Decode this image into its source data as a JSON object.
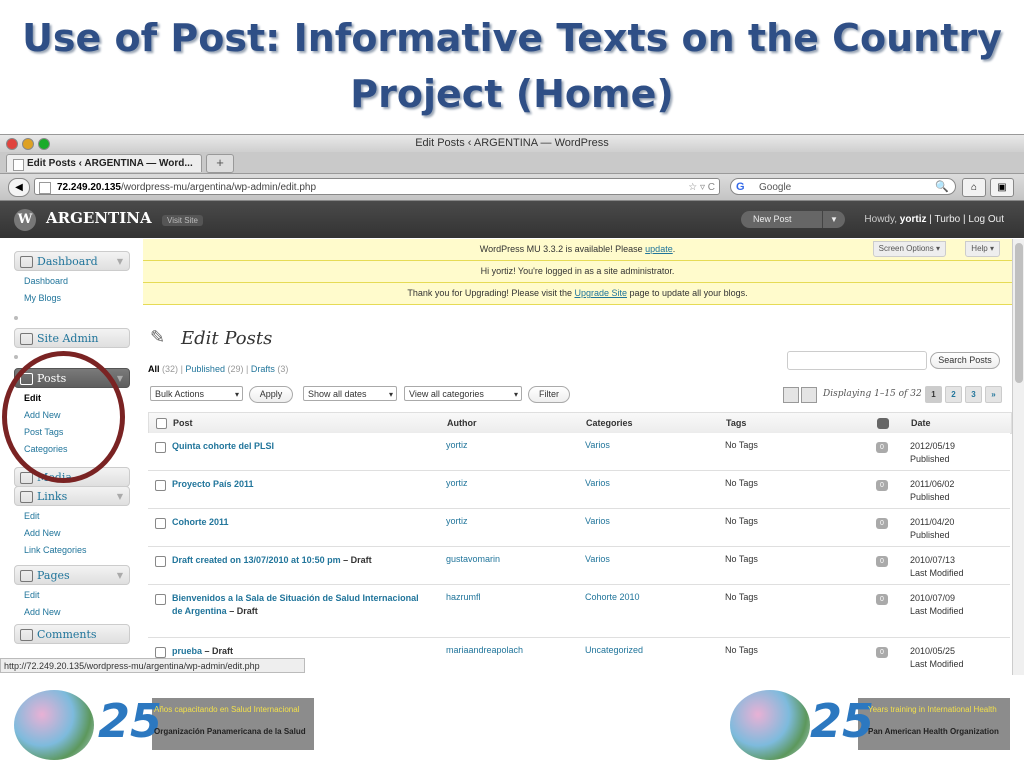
{
  "slide": {
    "title": "Use of Post: Informative Texts on the Country Project (Home)"
  },
  "browser": {
    "window_title": "Edit Posts ‹ ARGENTINA — WordPress",
    "tab_label": "Edit Posts ‹ ARGENTINA — Word...",
    "new_tab": "+",
    "back_icon": "◀",
    "url_host": "72.249.20.135",
    "url_path": "/wordpress-mu/argentina/wp-admin/edit.php",
    "url_right_controls": "☆ ▿ C",
    "search_engine_logo": "G",
    "search_placeholder": "Google",
    "search_icon": "🔍",
    "home_icon": "⌂",
    "menu_icon": "▣",
    "status_url": "http://72.249.20.135/wordpress-mu/argentina/wp-admin/edit.php"
  },
  "wp_header": {
    "logo": "W",
    "site_name": "ARGENTINA",
    "visit_site": "Visit Site",
    "new_post": "New Post",
    "dropdown_arrow": "▼",
    "howdy": "Howdy,",
    "user": "yortiz",
    "turbo": "Turbo",
    "logout": "Log Out",
    "separator": "|"
  },
  "notices": {
    "update_before": "WordPress MU 3.3.2 is available! Please ",
    "update_link": "update",
    "update_after": ".",
    "logged_in": "Hi yortiz! You're logged in as a site administrator.",
    "upgrade_before": "Thank you for Upgrading! Please visit the ",
    "upgrade_link": "Upgrade Site",
    "upgrade_after": " page to update all your blogs.",
    "screen_options": "Screen Options ▾",
    "help": "Help ▾"
  },
  "sidebar": {
    "dashboard": {
      "label": "Dashboard",
      "items": [
        "Dashboard",
        "My Blogs"
      ]
    },
    "site_admin": {
      "label": "Site Admin"
    },
    "posts": {
      "label": "Posts",
      "items": [
        "Edit",
        "Add New",
        "Post Tags",
        "Categories"
      ]
    },
    "media": {
      "label": "Media"
    },
    "links": {
      "label": "Links",
      "items": [
        "Edit",
        "Add New",
        "Link Categories"
      ]
    },
    "pages": {
      "label": "Pages",
      "items": [
        "Edit",
        "Add New"
      ]
    },
    "comments": {
      "label": "Comments"
    },
    "group_arrow": "▼"
  },
  "page": {
    "title": "Edit Posts",
    "pin_icon": "✎",
    "filter_all": "All",
    "filter_all_count": "(32)",
    "filter_published": "Published",
    "filter_published_count": "(29)",
    "filter_drafts": "Drafts",
    "filter_drafts_count": "(3)",
    "filter_separator": "|",
    "search_button": "Search Posts",
    "bulk_actions": "Bulk Actions",
    "apply": "Apply",
    "dates": "Show all dates",
    "categories": "View all categories",
    "filter": "Filter",
    "select_arrow": "▾",
    "displaying": "Displaying 1–15 of 32",
    "pages": [
      "1",
      "2",
      "3",
      "»"
    ]
  },
  "table": {
    "headers": {
      "post": "Post",
      "author": "Author",
      "categories": "Categories",
      "tags": "Tags",
      "date": "Date"
    },
    "rows": [
      {
        "title": "Quinta cohorte del PLSI",
        "status": "",
        "author": "yortiz",
        "category": "Varios",
        "tags": "No Tags",
        "comments": "0",
        "date": "2012/05/19",
        "state": "Published"
      },
      {
        "title": "Proyecto País 2011",
        "status": "",
        "author": "yortiz",
        "category": "Varios",
        "tags": "No Tags",
        "comments": "0",
        "date": "2011/06/02",
        "state": "Published"
      },
      {
        "title": "Cohorte 2011",
        "status": "",
        "author": "yortiz",
        "category": "Varios",
        "tags": "No Tags",
        "comments": "0",
        "date": "2011/04/20",
        "state": "Published"
      },
      {
        "title": "Draft created on 13/07/2010 at 10:50 pm",
        "status": " – Draft",
        "author": "gustavomarin",
        "category": "Varios",
        "tags": "No Tags",
        "comments": "0",
        "date": "2010/07/13",
        "state": "Last Modified"
      },
      {
        "title": "Bienvenidos a la Sala de Situación de Salud Internacional de Argentina",
        "status": " – Draft",
        "author": "hazrumfl",
        "category": "Cohorte 2010",
        "tags": "No Tags",
        "comments": "0",
        "date": "2010/07/09",
        "state": "Last Modified"
      },
      {
        "title": "prueba",
        "status": " – Draft",
        "author": "mariaandreapolach",
        "category": "Uncategorized",
        "tags": "No Tags",
        "comments": "0",
        "date": "2010/05/25",
        "state": "Last Modified"
      }
    ]
  },
  "banners": {
    "left_number": "25",
    "left_line1": "Años capacitando en Salud Internacional",
    "left_line3": "Organización Panamericana de la Salud",
    "right_number": "25",
    "right_line1": "Years training in International Health",
    "right_line3": "Pan American Health Organization"
  },
  "colors": {
    "title_blue": "#2f4f86",
    "wp_link": "#21759b",
    "notice_bg": "#fffbcc",
    "annotation_circle": "#7a2323",
    "banner_number": "#2c78c0"
  }
}
